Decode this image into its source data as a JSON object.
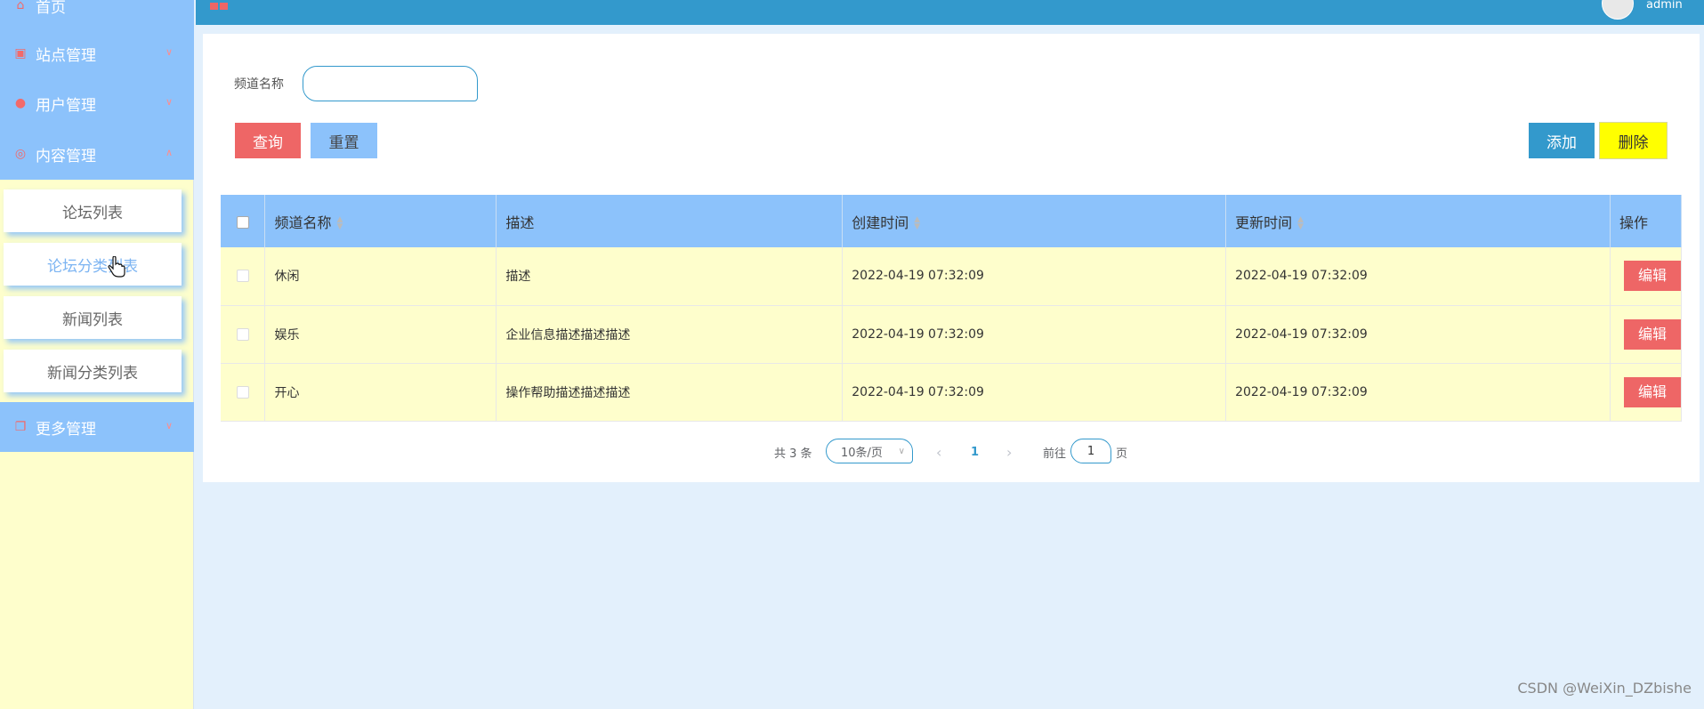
{
  "topbar": {
    "user": "admin"
  },
  "sidebar": {
    "items": [
      {
        "label": "首页",
        "icon": "home-icon"
      },
      {
        "label": "站点管理",
        "icon": "site-icon"
      },
      {
        "label": "用户管理",
        "icon": "user-icon"
      },
      {
        "label": "内容管理",
        "icon": "content-icon"
      }
    ],
    "sub_items": [
      {
        "label": "论坛列表"
      },
      {
        "label": "论坛分类列表"
      },
      {
        "label": "新闻列表"
      },
      {
        "label": "新闻分类列表"
      }
    ],
    "more": {
      "label": "更多管理",
      "icon": "more-icon"
    }
  },
  "search": {
    "label": "频道名称",
    "value": ""
  },
  "buttons": {
    "query": "查询",
    "reset": "重置",
    "add": "添加",
    "delete": "删除"
  },
  "table": {
    "headers": {
      "name": "频道名称",
      "desc": "描述",
      "created": "创建时间",
      "updated": "更新时间",
      "ops": "操作"
    },
    "rows": [
      {
        "name": "休闲",
        "desc": "描述",
        "created": "2022-04-19 07:32:09",
        "updated": "2022-04-19 07:32:09",
        "edit": "编辑"
      },
      {
        "name": "娱乐",
        "desc": "企业信息描述描述描述",
        "created": "2022-04-19 07:32:09",
        "updated": "2022-04-19 07:32:09",
        "edit": "编辑"
      },
      {
        "name": "开心",
        "desc": "操作帮助描述描述描述",
        "created": "2022-04-19 07:32:09",
        "updated": "2022-04-19 07:32:09",
        "edit": "编辑"
      }
    ]
  },
  "pagination": {
    "total": "共 3 条",
    "page_size": "10条/页",
    "current": "1",
    "goto": "前往",
    "jump_value": "1",
    "unit": "页"
  },
  "watermark": "CSDN @WeiXin_DZbishe",
  "colors": {
    "topbar": "#3399cc",
    "menu": "#8cc2fb",
    "sidebar": "#fefecc",
    "danger": "#ee6666",
    "warning": "#ffff00"
  }
}
